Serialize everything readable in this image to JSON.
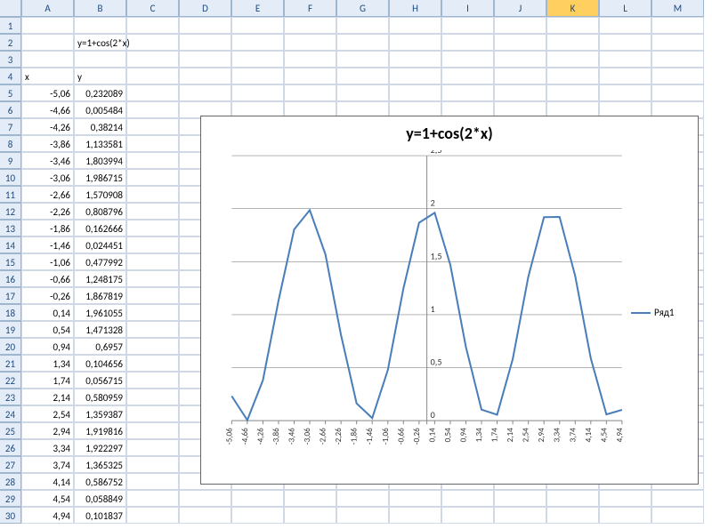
{
  "columns": [
    "A",
    "B",
    "C",
    "D",
    "E",
    "F",
    "G",
    "H",
    "I",
    "J",
    "K",
    "L",
    "M"
  ],
  "selected_column": "K",
  "formula_cell": {
    "ref": "B2",
    "text": "y=1+cos(2*x)"
  },
  "header_row": 4,
  "headers": {
    "A": "x",
    "B": "y"
  },
  "data_start_row": 5,
  "rows": [
    {
      "x": "-5,06",
      "y": "0,232089"
    },
    {
      "x": "-4,66",
      "y": "0,005484"
    },
    {
      "x": "-4,26",
      "y": "0,38214"
    },
    {
      "x": "-3,86",
      "y": "1,133581"
    },
    {
      "x": "-3,46",
      "y": "1,803994"
    },
    {
      "x": "-3,06",
      "y": "1,986715"
    },
    {
      "x": "-2,66",
      "y": "1,570908"
    },
    {
      "x": "-2,26",
      "y": "0,808796"
    },
    {
      "x": "-1,86",
      "y": "0,162666"
    },
    {
      "x": "-1,46",
      "y": "0,024451"
    },
    {
      "x": "-1,06",
      "y": "0,477992"
    },
    {
      "x": "-0,66",
      "y": "1,248175"
    },
    {
      "x": "-0,26",
      "y": "1,867819"
    },
    {
      "x": "0,14",
      "y": "1,961055"
    },
    {
      "x": "0,54",
      "y": "1,471328"
    },
    {
      "x": "0,94",
      "y": "0,6957"
    },
    {
      "x": "1,34",
      "y": "0,104656"
    },
    {
      "x": "1,74",
      "y": "0,056715"
    },
    {
      "x": "2,14",
      "y": "0,580959"
    },
    {
      "x": "2,54",
      "y": "1,359387"
    },
    {
      "x": "2,94",
      "y": "1,919816"
    },
    {
      "x": "3,34",
      "y": "1,922297"
    },
    {
      "x": "3,74",
      "y": "1,365325"
    },
    {
      "x": "4,14",
      "y": "0,586752"
    },
    {
      "x": "4,54",
      "y": "0,058849"
    },
    {
      "x": "4,94",
      "y": "0,101837"
    }
  ],
  "chart": {
    "title": "y=1+cos(2*x)",
    "legend": "Ряд1",
    "y_ticks": [
      0,
      0.5,
      1,
      1.5,
      2,
      2.5
    ],
    "y_tick_labels": [
      "0",
      "0,5",
      "1",
      "1,5",
      "2",
      "2,5"
    ]
  },
  "chart_data": {
    "type": "line",
    "title": "y=1+cos(2*x)",
    "xlabel": "",
    "ylabel": "",
    "ylim": [
      0,
      2.5
    ],
    "categories": [
      "-5,06",
      "-4,66",
      "-4,26",
      "-3,86",
      "-3,46",
      "-3,06",
      "-2,66",
      "-2,26",
      "-1,86",
      "-1,46",
      "-1,06",
      "-0,66",
      "-0,26",
      "0,14",
      "0,54",
      "0,94",
      "1,34",
      "1,74",
      "2,14",
      "2,54",
      "2,94",
      "3,34",
      "3,74",
      "4,14",
      "4,54",
      "4,94"
    ],
    "series": [
      {
        "name": "Ряд1",
        "values": [
          0.232089,
          0.005484,
          0.38214,
          1.133581,
          1.803994,
          1.986715,
          1.570908,
          0.808796,
          0.162666,
          0.024451,
          0.477992,
          1.248175,
          1.867819,
          1.961055,
          1.471328,
          0.6957,
          0.104656,
          0.056715,
          0.580959,
          1.359387,
          1.919816,
          1.922297,
          1.365325,
          0.586752,
          0.058849,
          0.101837
        ]
      }
    ]
  }
}
